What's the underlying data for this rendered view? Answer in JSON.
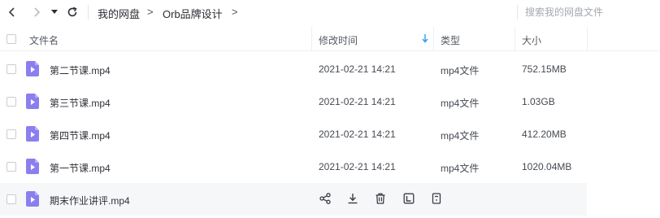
{
  "toolbar": {
    "breadcrumb": [
      "我的网盘",
      "Orb品牌设计"
    ],
    "breadcrumb_separator": ">",
    "search_placeholder": "搜索我的网盘文件"
  },
  "table": {
    "columns": {
      "name": "文件名",
      "modified": "修改时间",
      "type": "类型",
      "size": "大小"
    },
    "sort_column": "modified",
    "rows": [
      {
        "name": "第二节课.mp4",
        "modified": "2021-02-21 14:21",
        "type": "mp4文件",
        "size": "752.15MB"
      },
      {
        "name": "第三节课.mp4",
        "modified": "2021-02-21 14:21",
        "type": "mp4文件",
        "size": "1.03GB"
      },
      {
        "name": "第四节课.mp4",
        "modified": "2021-02-21 14:21",
        "type": "mp4文件",
        "size": "412.20MB"
      },
      {
        "name": "第一节课.mp4",
        "modified": "2021-02-21 14:21",
        "type": "mp4文件",
        "size": "1020.04MB"
      },
      {
        "name": "期末作业讲评.mp4",
        "hovered": true,
        "actions": [
          "share-icon",
          "download-icon",
          "delete-icon",
          "text-icon",
          "more-icon"
        ]
      }
    ]
  },
  "colors": {
    "file_icon": "#8b7ff0",
    "sort_arrow": "#2d9df0",
    "hover_row": "#f6f7f9"
  }
}
